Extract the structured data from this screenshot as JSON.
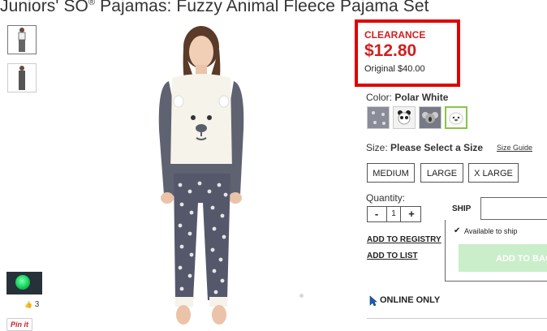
{
  "product": {
    "title_pre": "Juniors' SO",
    "title_reg": "®",
    "title_post": " Pajamas: Fuzzy Animal Fleece Pajama Set"
  },
  "price": {
    "badge": "CLEARANCE",
    "sale": "$12.80",
    "original": "Original $40.00",
    "accent_color": "#d01f1f"
  },
  "color": {
    "label": "Color:",
    "selected": "Polar White",
    "swatches": [
      "gray-pattern-icon",
      "panda-icon",
      "koala-icon",
      "polar-bear-icon"
    ]
  },
  "size": {
    "label": "Size:",
    "prompt": "Please Select a Size",
    "guide": "Size Guide",
    "options": [
      "MEDIUM",
      "LARGE",
      "X LARGE"
    ]
  },
  "quantity": {
    "label": "Quantity:",
    "minus": "-",
    "value": "1",
    "plus": "+"
  },
  "links": {
    "registry": "ADD TO REGISTRY",
    "list": "ADD TO LIST"
  },
  "ship": {
    "tab": "SHIP",
    "status": "Available to ship",
    "check": "✔",
    "add_button": "ADD TO BAG"
  },
  "online": "ONLINE ONLY",
  "social": {
    "likes": "3",
    "like_glyph": "👍",
    "pin": "Pin it"
  }
}
